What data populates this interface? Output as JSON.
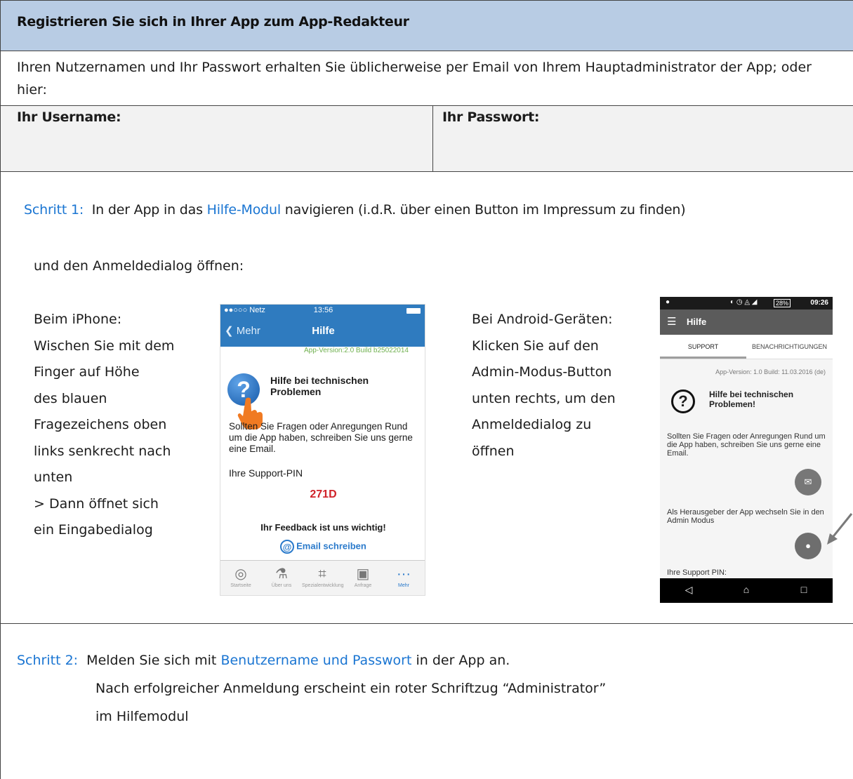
{
  "table": {
    "title": "Registrieren Sie sich in Ihrer App zum App-Redakteur",
    "intro": "Ihren Nutzernamen und Ihr Passwort erhalten Sie üblicherweise per Email von Ihrem Hauptadministrator der App; oder hier:",
    "username_label": "Ihr Username:",
    "password_label": "Ihr Passwort:"
  },
  "step1": {
    "label": "Schritt 1:",
    "text_before": "In der App in das",
    "highlight": "Hilfe-Modul",
    "text_after": "navigieren (i.d.R. über einen Button im Impressum zu finden)",
    "sub": "und den Anmeldedialog öffnen:",
    "iphone": {
      "prefix": "Beim",
      "device": "iPhone",
      "suffix": ":",
      "lines": [
        "Wischen Sie mit dem",
        "Finger auf Höhe",
        "des blauen",
        "Fragezeichens oben",
        "links senkrecht nach",
        "unten",
        "> Dann öffnet sich",
        "ein Eingabedialog"
      ]
    },
    "android": {
      "prefix": "Bei",
      "device": "Android",
      "suffix": "-Geräten:",
      "lines": [
        "Klicken Sie auf den",
        "Admin-Modus-Button",
        "unten rechts, um den",
        "Anmeldedialog zu",
        "öffnen"
      ]
    }
  },
  "step2": {
    "label": "Schritt 2:",
    "text_before": "Melden Sie sich mit",
    "highlight": "Benutzername und Passwort",
    "text_after": "in der App an.",
    "line2": "Nach erfolgreicher Anmeldung erscheint ein roter Schriftzug “Administrator”",
    "line3": "im Hilfemodul"
  },
  "iphone_screen": {
    "status_carrier": "●●○○○ Netz",
    "status_time": "13:56",
    "back": "Mehr",
    "title": "Hilfe",
    "version": "App-Version:2.0 Build b25022014",
    "help_title": "Hilfe bei technischen Problemen",
    "body": "Sollten Sie Fragen oder Anregungen Rund um die App haben, schreiben Sie uns gerne eine Email.",
    "pin_label": "Ihre Support-PIN",
    "pin": "271D",
    "feedback": "Ihr Feedback ist uns wichtig!",
    "email_btn": "Email schreiben",
    "tabs": [
      {
        "icon": "target-icon",
        "label": "Startseite"
      },
      {
        "icon": "flask-icon",
        "label": "Über uns"
      },
      {
        "icon": "crop-icon",
        "label": "Spezialentwicklung"
      },
      {
        "icon": "contact-icon",
        "label": "Anfrage"
      },
      {
        "icon": "more-icon",
        "label": "Mehr"
      }
    ],
    "accent": "#2f7bbf",
    "pin_color": "#d0232a"
  },
  "android_screen": {
    "status_time": "09:26",
    "status_battery": "28%",
    "title": "Hilfe",
    "tab_support": "SUPPORT",
    "tab_notifications": "BENACHRICHTIGUNGEN",
    "version": "App-Version: 1.0 Build: 11.03.2016 (de)",
    "help_title": "Hilfe bei technischen Problemen!",
    "body": "Sollten Sie Fragen oder Anregungen Rund um die App haben, schreiben Sie uns gerne eine Email.",
    "admin_text": "Als Herausgeber der App wechseln Sie in den Admin Modus",
    "pin_label": "Ihre Support PIN:"
  },
  "colors": {
    "header_bg": "#b8cce4",
    "cred_bg": "#f2f2f2",
    "accent_blue": "#1a75d2"
  }
}
